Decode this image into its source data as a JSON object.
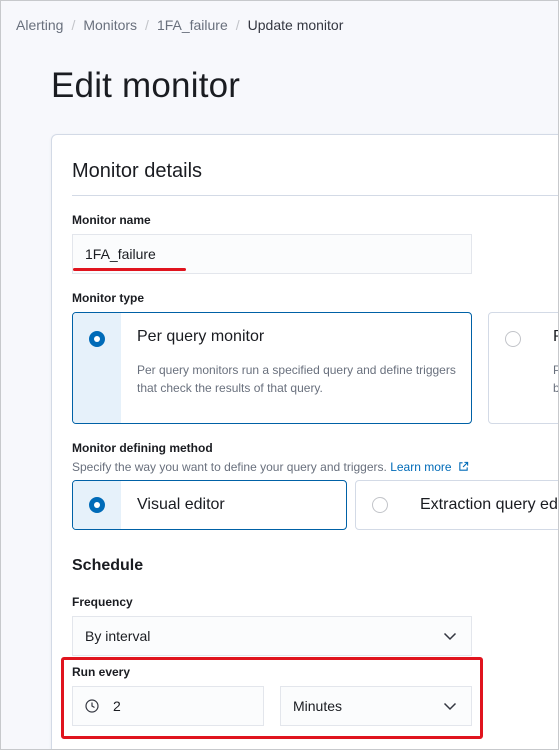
{
  "breadcrumbs": [
    {
      "label": "Alerting"
    },
    {
      "label": "Monitors"
    },
    {
      "label": "1FA_failure"
    },
    {
      "label": "Update monitor"
    }
  ],
  "page_title": "Edit monitor",
  "monitor_details": {
    "title": "Monitor details",
    "name_label": "Monitor name",
    "name_value": "1FA_failure",
    "type_label": "Monitor type",
    "type_options": [
      {
        "title": "Per query monitor",
        "description": "Per query monitors run a specified query and define triggers that check the results of that query.",
        "selected": true
      },
      {
        "title": "P",
        "description_lines": [
          "P",
          "b"
        ],
        "selected": false
      }
    ],
    "method_label": "Monitor defining method",
    "method_help": "Specify the way you want to define your query and triggers.",
    "method_help_link": "Learn more",
    "method_options": [
      {
        "title": "Visual editor",
        "selected": true
      },
      {
        "title": "Extraction query ed",
        "selected": false
      }
    ]
  },
  "schedule": {
    "title": "Schedule",
    "frequency_label": "Frequency",
    "frequency_value": "By interval",
    "run_every_label": "Run every",
    "interval_value": "2",
    "interval_unit": "Minutes"
  },
  "colors": {
    "accent": "#006bb8",
    "annotation_red": "#e0141e",
    "selected_rail": "#e6f1fa"
  }
}
